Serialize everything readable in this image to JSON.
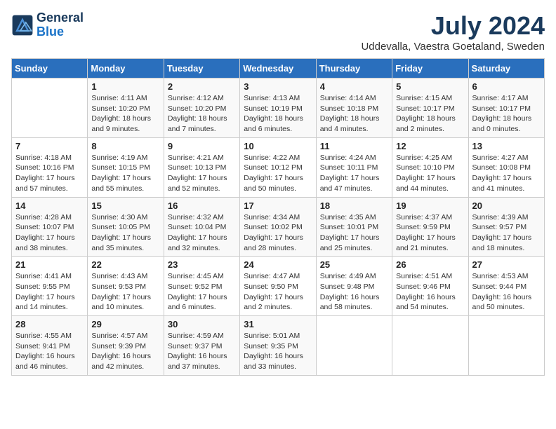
{
  "header": {
    "logo_line1": "General",
    "logo_line2": "Blue",
    "month_title": "July 2024",
    "location": "Uddevalla, Vaestra Goetaland, Sweden"
  },
  "weekdays": [
    "Sunday",
    "Monday",
    "Tuesday",
    "Wednesday",
    "Thursday",
    "Friday",
    "Saturday"
  ],
  "weeks": [
    [
      {
        "day": "",
        "info": ""
      },
      {
        "day": "1",
        "info": "Sunrise: 4:11 AM\nSunset: 10:20 PM\nDaylight: 18 hours\nand 9 minutes."
      },
      {
        "day": "2",
        "info": "Sunrise: 4:12 AM\nSunset: 10:20 PM\nDaylight: 18 hours\nand 7 minutes."
      },
      {
        "day": "3",
        "info": "Sunrise: 4:13 AM\nSunset: 10:19 PM\nDaylight: 18 hours\nand 6 minutes."
      },
      {
        "day": "4",
        "info": "Sunrise: 4:14 AM\nSunset: 10:18 PM\nDaylight: 18 hours\nand 4 minutes."
      },
      {
        "day": "5",
        "info": "Sunrise: 4:15 AM\nSunset: 10:17 PM\nDaylight: 18 hours\nand 2 minutes."
      },
      {
        "day": "6",
        "info": "Sunrise: 4:17 AM\nSunset: 10:17 PM\nDaylight: 18 hours\nand 0 minutes."
      }
    ],
    [
      {
        "day": "7",
        "info": "Sunrise: 4:18 AM\nSunset: 10:16 PM\nDaylight: 17 hours\nand 57 minutes."
      },
      {
        "day": "8",
        "info": "Sunrise: 4:19 AM\nSunset: 10:15 PM\nDaylight: 17 hours\nand 55 minutes."
      },
      {
        "day": "9",
        "info": "Sunrise: 4:21 AM\nSunset: 10:13 PM\nDaylight: 17 hours\nand 52 minutes."
      },
      {
        "day": "10",
        "info": "Sunrise: 4:22 AM\nSunset: 10:12 PM\nDaylight: 17 hours\nand 50 minutes."
      },
      {
        "day": "11",
        "info": "Sunrise: 4:24 AM\nSunset: 10:11 PM\nDaylight: 17 hours\nand 47 minutes."
      },
      {
        "day": "12",
        "info": "Sunrise: 4:25 AM\nSunset: 10:10 PM\nDaylight: 17 hours\nand 44 minutes."
      },
      {
        "day": "13",
        "info": "Sunrise: 4:27 AM\nSunset: 10:08 PM\nDaylight: 17 hours\nand 41 minutes."
      }
    ],
    [
      {
        "day": "14",
        "info": "Sunrise: 4:28 AM\nSunset: 10:07 PM\nDaylight: 17 hours\nand 38 minutes."
      },
      {
        "day": "15",
        "info": "Sunrise: 4:30 AM\nSunset: 10:05 PM\nDaylight: 17 hours\nand 35 minutes."
      },
      {
        "day": "16",
        "info": "Sunrise: 4:32 AM\nSunset: 10:04 PM\nDaylight: 17 hours\nand 32 minutes."
      },
      {
        "day": "17",
        "info": "Sunrise: 4:34 AM\nSunset: 10:02 PM\nDaylight: 17 hours\nand 28 minutes."
      },
      {
        "day": "18",
        "info": "Sunrise: 4:35 AM\nSunset: 10:01 PM\nDaylight: 17 hours\nand 25 minutes."
      },
      {
        "day": "19",
        "info": "Sunrise: 4:37 AM\nSunset: 9:59 PM\nDaylight: 17 hours\nand 21 minutes."
      },
      {
        "day": "20",
        "info": "Sunrise: 4:39 AM\nSunset: 9:57 PM\nDaylight: 17 hours\nand 18 minutes."
      }
    ],
    [
      {
        "day": "21",
        "info": "Sunrise: 4:41 AM\nSunset: 9:55 PM\nDaylight: 17 hours\nand 14 minutes."
      },
      {
        "day": "22",
        "info": "Sunrise: 4:43 AM\nSunset: 9:53 PM\nDaylight: 17 hours\nand 10 minutes."
      },
      {
        "day": "23",
        "info": "Sunrise: 4:45 AM\nSunset: 9:52 PM\nDaylight: 17 hours\nand 6 minutes."
      },
      {
        "day": "24",
        "info": "Sunrise: 4:47 AM\nSunset: 9:50 PM\nDaylight: 17 hours\nand 2 minutes."
      },
      {
        "day": "25",
        "info": "Sunrise: 4:49 AM\nSunset: 9:48 PM\nDaylight: 16 hours\nand 58 minutes."
      },
      {
        "day": "26",
        "info": "Sunrise: 4:51 AM\nSunset: 9:46 PM\nDaylight: 16 hours\nand 54 minutes."
      },
      {
        "day": "27",
        "info": "Sunrise: 4:53 AM\nSunset: 9:44 PM\nDaylight: 16 hours\nand 50 minutes."
      }
    ],
    [
      {
        "day": "28",
        "info": "Sunrise: 4:55 AM\nSunset: 9:41 PM\nDaylight: 16 hours\nand 46 minutes."
      },
      {
        "day": "29",
        "info": "Sunrise: 4:57 AM\nSunset: 9:39 PM\nDaylight: 16 hours\nand 42 minutes."
      },
      {
        "day": "30",
        "info": "Sunrise: 4:59 AM\nSunset: 9:37 PM\nDaylight: 16 hours\nand 37 minutes."
      },
      {
        "day": "31",
        "info": "Sunrise: 5:01 AM\nSunset: 9:35 PM\nDaylight: 16 hours\nand 33 minutes."
      },
      {
        "day": "",
        "info": ""
      },
      {
        "day": "",
        "info": ""
      },
      {
        "day": "",
        "info": ""
      }
    ]
  ]
}
